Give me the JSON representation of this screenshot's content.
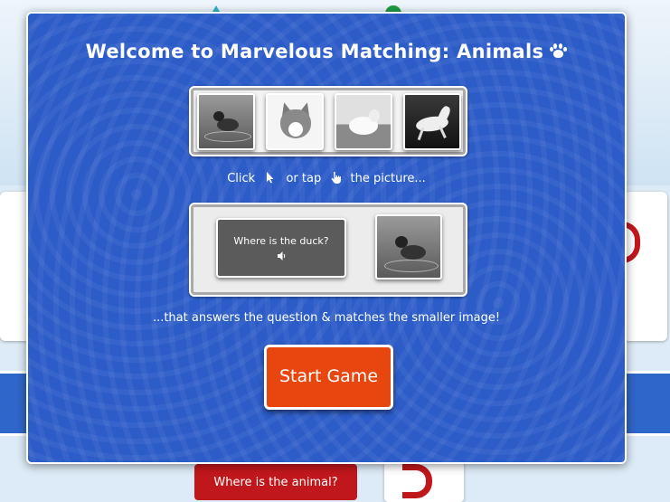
{
  "modal": {
    "title": "Welcome to Marvelous Matching: Animals",
    "thumbnails": [
      "duck",
      "cat",
      "lamb",
      "horse"
    ],
    "instruction_click": "Click",
    "instruction_or_tap": "or tap",
    "instruction_picture": "the picture...",
    "example": {
      "question": "Where is the duck?"
    },
    "instruction_answer": "...that answers the question & matches the smaller image!",
    "start_button": "Start Game"
  },
  "background": {
    "question_button": "Where is the animal?"
  },
  "colors": {
    "modal_blue": "#2c5cc8",
    "start_orange": "#e8460f",
    "background_red": "#c0171c"
  },
  "icons": [
    "paw-icon",
    "cursor-icon",
    "hand-icon",
    "speaker-icon"
  ]
}
